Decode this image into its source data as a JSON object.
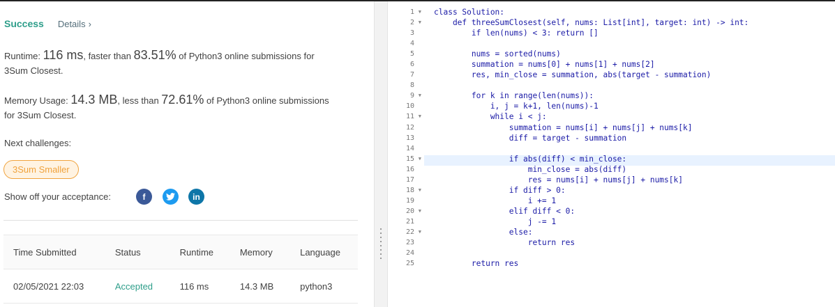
{
  "status": {
    "label": "Success",
    "details_label": "Details",
    "details_icon": "chevron-right-icon"
  },
  "runtime": {
    "prefix": "Runtime: ",
    "value": "116 ms",
    "middle": ", faster than ",
    "percent": "83.51%",
    "suffix": " of Python3 online submissions for",
    "line2": "3Sum Closest."
  },
  "memory": {
    "prefix": "Memory Usage: ",
    "value": "14.3 MB",
    "middle": ", less than ",
    "percent": "72.61%",
    "suffix": " of Python3 online submissions",
    "line2": "for 3Sum Closest."
  },
  "next": {
    "label": "Next challenges:",
    "items": [
      "3Sum Smaller"
    ]
  },
  "share": {
    "label": "Show off your acceptance:",
    "icons": [
      "facebook-icon",
      "twitter-icon",
      "linkedin-icon"
    ],
    "fb_glyph": "f",
    "li_glyph": "in"
  },
  "table": {
    "headers": [
      "Time Submitted",
      "Status",
      "Runtime",
      "Memory",
      "Language"
    ],
    "rows": [
      [
        "02/05/2021 22:03",
        "Accepted",
        "116 ms",
        "14.3 MB",
        "python3"
      ]
    ]
  },
  "colors": {
    "success": "#2e9e8a",
    "keyword_blue": "#1a1aa6",
    "pill_orange": "#f0a23c",
    "facebook": "#3b5998",
    "twitter": "#1d9bf0",
    "linkedin": "#0e76a8"
  },
  "editor": {
    "folds": [
      1,
      2,
      9,
      11,
      15,
      18,
      20,
      22
    ],
    "active_line": 15,
    "lines": [
      "class Solution:",
      "    def threeSumClosest(self, nums: List[int], target: int) -> int:",
      "        if len(nums) < 3: return []",
      "",
      "        nums = sorted(nums)",
      "        summation = nums[0] + nums[1] + nums[2]",
      "        res, min_close = summation, abs(target - summation)",
      "",
      "        for k in range(len(nums)):",
      "            i, j = k+1, len(nums)-1",
      "            while i < j:",
      "                summation = nums[i] + nums[j] + nums[k]",
      "                diff = target - summation",
      "",
      "                if abs(diff) < min_close:",
      "                    min_close = abs(diff)",
      "                    res = nums[i] + nums[j] + nums[k]",
      "                if diff > 0:",
      "                    i += 1",
      "                elif diff < 0:",
      "                    j -= 1",
      "                else:",
      "                    return res",
      "",
      "        return res"
    ]
  }
}
